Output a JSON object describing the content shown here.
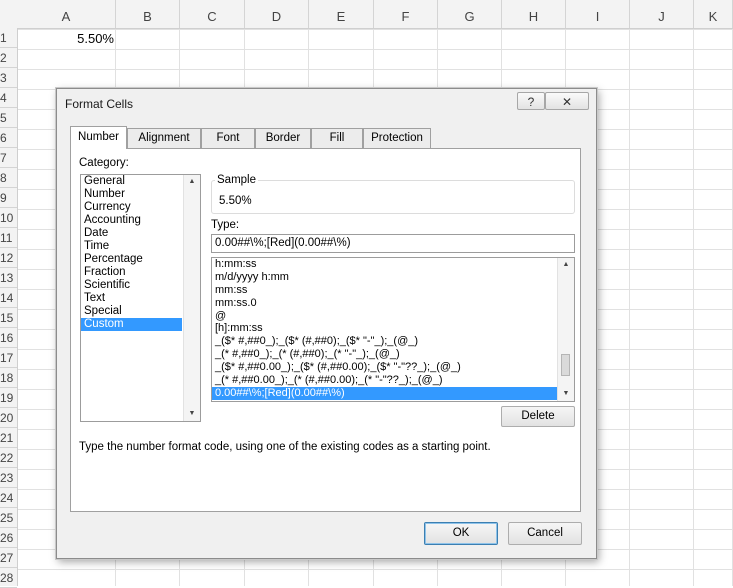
{
  "sheet": {
    "columns": [
      "A",
      "B",
      "C",
      "D",
      "E",
      "F",
      "G",
      "H",
      "I",
      "J",
      "K"
    ],
    "rows": [
      "1",
      "2",
      "3",
      "4",
      "5",
      "6",
      "7",
      "8",
      "9",
      "10",
      "11",
      "12",
      "13",
      "14",
      "15",
      "16",
      "17",
      "18",
      "19",
      "20",
      "21",
      "22",
      "23",
      "24",
      "25",
      "26",
      "27",
      "28"
    ],
    "cell_a1": "5.50%"
  },
  "dialog": {
    "title": "Format Cells",
    "help_glyph": "?",
    "close_glyph": "✕",
    "tabs": [
      "Number",
      "Alignment",
      "Font",
      "Border",
      "Fill",
      "Protection"
    ],
    "active_tab": "Number",
    "category_label": "Category:",
    "categories": [
      "General",
      "Number",
      "Currency",
      "Accounting",
      "Date",
      "Time",
      "Percentage",
      "Fraction",
      "Scientific",
      "Text",
      "Special",
      "Custom"
    ],
    "selected_category": "Custom",
    "sample_label": "Sample",
    "sample_value": "5.50%",
    "type_label": "Type:",
    "type_value": "0.00##\\%;[Red](0.00##\\%)",
    "format_list": [
      "h:mm:ss",
      "m/d/yyyy h:mm",
      "mm:ss",
      "mm:ss.0",
      "@",
      "[h]:mm:ss",
      "_($* #,##0_);_($* (#,##0);_($* \"-\"_);_(@_)",
      "_(* #,##0_);_(* (#,##0);_(* \"-\"_);_(@_)",
      "_($* #,##0.00_);_($* (#,##0.00);_($* \"-\"??_);_(@_)",
      "_(* #,##0.00_);_(* (#,##0.00);_(* \"-\"??_);_(@_)",
      "0.00##\\%;[Red](0.00##\\%)"
    ],
    "selected_format": "0.00##\\%;[Red](0.00##\\%)",
    "delete_label": "Delete",
    "description": "Type the number format code, using one of the existing codes as a starting point.",
    "ok_label": "OK",
    "cancel_label": "Cancel"
  }
}
